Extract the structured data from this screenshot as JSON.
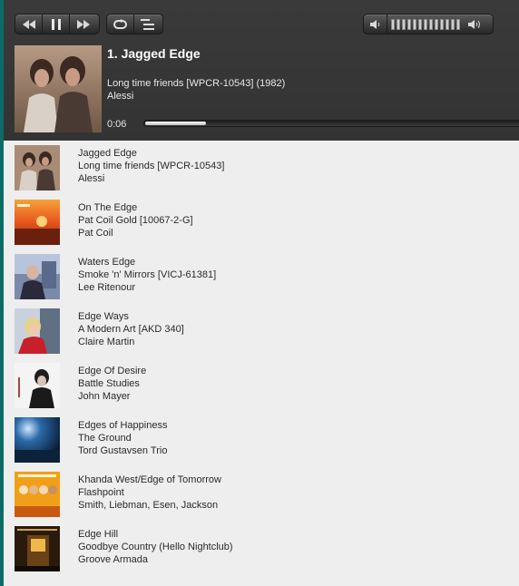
{
  "controls": {
    "icons": [
      "rewind-icon",
      "pause-icon",
      "fast-forward-icon",
      "repeat-icon",
      "playlist-icon",
      "volume-down-icon",
      "volume-up-icon"
    ],
    "volume_level_fraction": 1.0
  },
  "now_playing": {
    "title": "1. Jagged Edge",
    "album": "Long time friends [WPCR-10543] (1982)",
    "artist": "Alessi",
    "elapsed": "0:06",
    "progress_fraction": 0.04
  },
  "playlist": [
    {
      "title": "Jagged Edge",
      "album": "Long time friends [WPCR-10543]",
      "artist": "Alessi"
    },
    {
      "title": "On The Edge",
      "album": "Pat Coil Gold [10067-2-G]",
      "artist": "Pat Coil"
    },
    {
      "title": "Waters Edge",
      "album": "Smoke 'n' Mirrors [VICJ-61381]",
      "artist": "Lee Ritenour"
    },
    {
      "title": "Edge Ways",
      "album": "A Modern Art [AKD 340]",
      "artist": "Claire Martin"
    },
    {
      "title": "Edge Of Desire",
      "album": "Battle Studies",
      "artist": "John Mayer"
    },
    {
      "title": "Edges of Happiness",
      "album": "The Ground",
      "artist": "Tord Gustavsen Trio"
    },
    {
      "title": "Khanda West/Edge of Tomorrow",
      "album": "Flashpoint",
      "artist": "Smith, Liebman, Esen, Jackson"
    },
    {
      "title": "Edge Hill",
      "album": "Goodbye Country (Hello Nightclub)",
      "artist": "Groove Armada"
    }
  ]
}
